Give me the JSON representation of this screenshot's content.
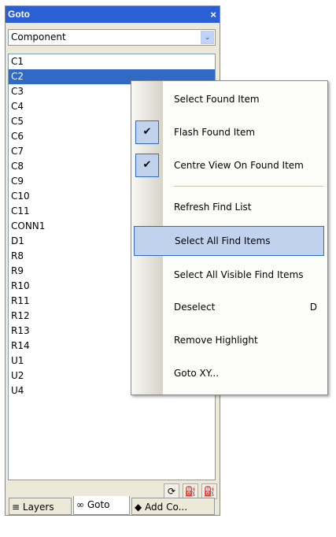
{
  "panel": {
    "title": "Goto",
    "close_glyph": "×"
  },
  "combo": {
    "value": "Component",
    "dropdown_glyph": "⌄"
  },
  "list": {
    "items": [
      "C1",
      "C2",
      "C3",
      "C4",
      "C5",
      "C6",
      "C7",
      "C8",
      "C9",
      "C10",
      "C11",
      "CONN1",
      "D1",
      "R8",
      "R9",
      "R10",
      "R11",
      "R12",
      "R13",
      "R14",
      "U1",
      "U2",
      "U4"
    ],
    "selected_index": 1
  },
  "toolbar": {
    "refresh_icon": "⟳",
    "find_prev_icon": "⛽",
    "find_next_icon": "⛽"
  },
  "tabs": [
    {
      "label": "Layers",
      "icon": "layers-icon",
      "glyph": "≡"
    },
    {
      "label": "Goto",
      "icon": "binoculars-icon",
      "glyph": "∞"
    },
    {
      "label": "Add Co...",
      "icon": "component-icon",
      "glyph": "◆"
    }
  ],
  "menu": {
    "items": [
      {
        "label": "Select Found Item",
        "checked": false,
        "shortcut": ""
      },
      {
        "label": "Flash Found Item",
        "checked": true,
        "shortcut": ""
      },
      {
        "label": "Centre View On Found Item",
        "checked": true,
        "shortcut": ""
      },
      {
        "label": "Refresh Find List",
        "checked": false,
        "shortcut": ""
      },
      {
        "label": "Select All Find Items",
        "checked": false,
        "shortcut": "",
        "highlighted": true
      },
      {
        "label": "Select All Visible Find Items",
        "checked": false,
        "shortcut": ""
      },
      {
        "label": "Deselect",
        "checked": false,
        "shortcut": "D"
      },
      {
        "label": "Remove Highlight",
        "checked": false,
        "shortcut": ""
      },
      {
        "label": "Goto XY...",
        "checked": false,
        "shortcut": ""
      }
    ],
    "check_glyph": "✔"
  },
  "colors": {
    "titlebar": "#2b5fd6",
    "selection": "#316ac5",
    "menu_highlight": "#c1d2ee"
  }
}
